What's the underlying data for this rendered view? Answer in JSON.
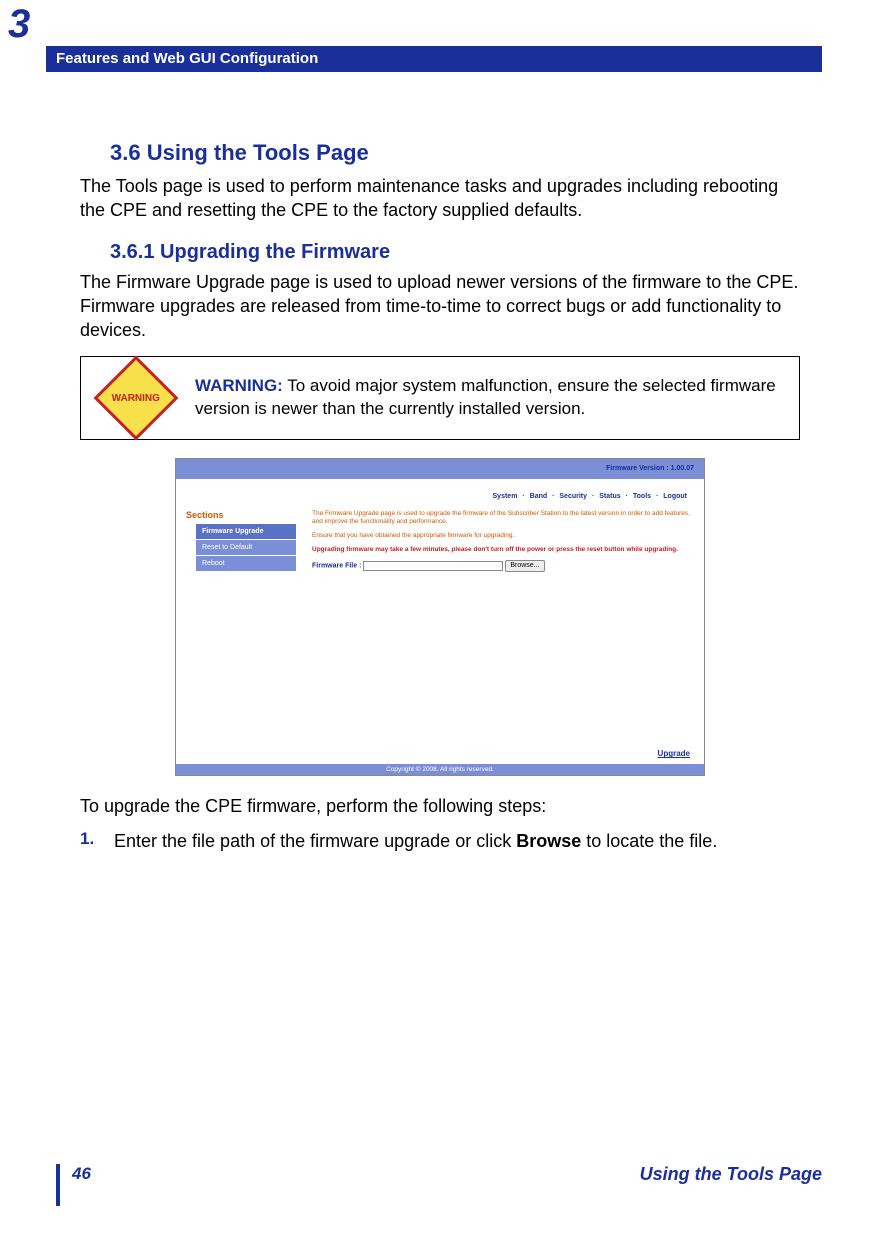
{
  "chapter_number": "3",
  "header_title": "Features and Web GUI Configuration",
  "section_heading": "3.6 Using the Tools Page",
  "section_intro": "The Tools page is used to perform maintenance tasks and upgrades including rebooting the CPE and resetting the CPE to the factory supplied defaults.",
  "subsection_heading": "3.6.1 Upgrading the Firmware",
  "subsection_intro": "The Firmware Upgrade page is used to upload newer versions of the firmware to the CPE. Firmware upgrades are released from time-to-time to correct bugs or add functionality to devices.",
  "warning": {
    "icon_label": "WARNING",
    "label": "WARNING:",
    "text": " To avoid major system malfunction, ensure the selected firmware version is newer than the currently installed version."
  },
  "screenshot": {
    "firmware_version": "Firmware Version : 1.00.07",
    "nav": [
      "System",
      "Band",
      "Security",
      "Status",
      "Tools",
      "Logout"
    ],
    "sections_label": "Sections",
    "sidebar": [
      "Firmware Upgrade",
      "Reset to Default",
      "Reboot"
    ],
    "p1": "The Firmware Upgrade page is used to upgrade the firmware of the Subscriber Station to the latest version in order to add features, and improve the functionality and performance.",
    "p2": "Ensure that you have obtained the appropriate firmware for upgrading.",
    "warn": "Upgrading firmware may take a few minutes, please don't turn off the power or press the reset button while upgrading.",
    "file_label": "Firmware File :",
    "browse": "Browse...",
    "upgrade": "Upgrade",
    "copyright": "Copyright © 2008.  All rights reserved."
  },
  "post_screenshot": "To upgrade the CPE firmware, perform the following steps:",
  "step": {
    "num": "1.",
    "text_before": "Enter the file path of the firmware upgrade or click ",
    "bold": "Browse",
    "text_after": " to locate the file."
  },
  "footer": {
    "page_num": "46",
    "title": "Using the Tools Page"
  }
}
